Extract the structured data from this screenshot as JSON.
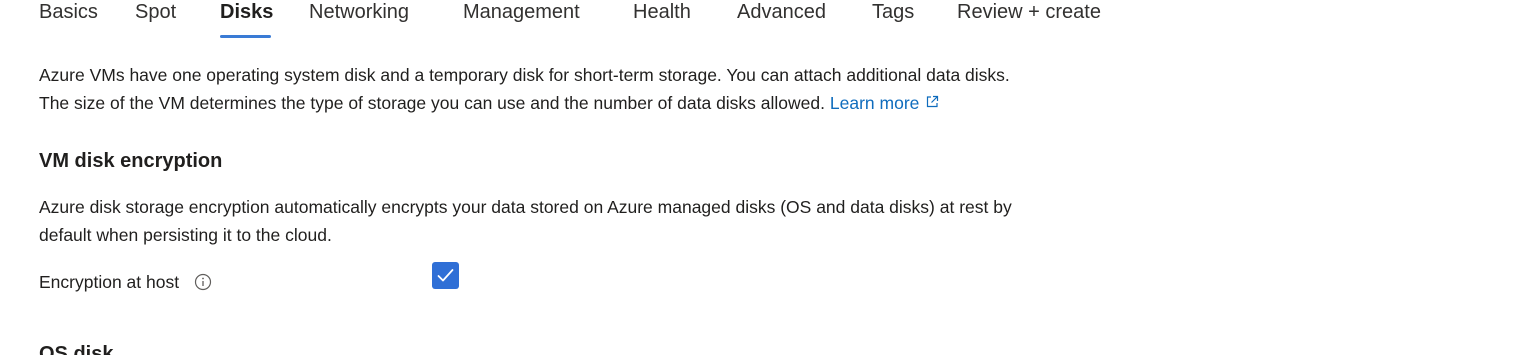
{
  "tabs": [
    {
      "label": "Basics",
      "active": false
    },
    {
      "label": "Spot",
      "active": false
    },
    {
      "label": "Disks",
      "active": true
    },
    {
      "label": "Networking",
      "active": false
    },
    {
      "label": "Management",
      "active": false
    },
    {
      "label": "Health",
      "active": false
    },
    {
      "label": "Advanced",
      "active": false
    },
    {
      "label": "Tags",
      "active": false
    },
    {
      "label": "Review + create",
      "active": false
    }
  ],
  "intro": {
    "line1": "Azure VMs have one operating system disk and a temporary disk for short-term storage. You can attach additional data disks.",
    "line2": "The size of the VM determines the type of storage you can use and the number of data disks allowed.",
    "learn_more": "Learn more",
    "learn_more_icon": "external-link-icon"
  },
  "encryption": {
    "heading": "VM disk encryption",
    "desc_line1": "Azure disk storage encryption automatically encrypts your data stored on Azure managed disks (OS and data disks) at rest by",
    "desc_line2": "default when persisting it to the cloud.",
    "host_label": "Encryption at host",
    "host_info_icon": "info-icon",
    "host_checked": true
  },
  "os_disk": {
    "heading": "OS disk"
  },
  "colors": {
    "accent": "#3a7bd5",
    "link": "#0f6cbd",
    "checkbox": "#2f6fd6",
    "text": "#201f1e"
  }
}
